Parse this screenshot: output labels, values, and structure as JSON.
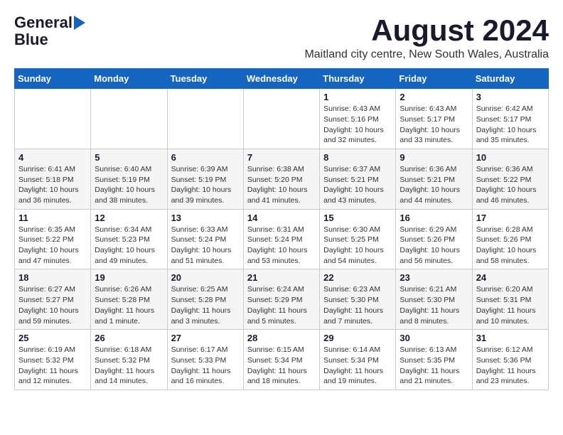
{
  "header": {
    "logo_line1": "General",
    "logo_line2": "Blue",
    "title": "August 2024",
    "subtitle": "Maitland city centre, New South Wales, Australia"
  },
  "days_of_week": [
    "Sunday",
    "Monday",
    "Tuesday",
    "Wednesday",
    "Thursday",
    "Friday",
    "Saturday"
  ],
  "weeks": [
    [
      {
        "day": "",
        "detail": ""
      },
      {
        "day": "",
        "detail": ""
      },
      {
        "day": "",
        "detail": ""
      },
      {
        "day": "",
        "detail": ""
      },
      {
        "day": "1",
        "detail": "Sunrise: 6:43 AM\nSunset: 5:16 PM\nDaylight: 10 hours\nand 32 minutes."
      },
      {
        "day": "2",
        "detail": "Sunrise: 6:43 AM\nSunset: 5:17 PM\nDaylight: 10 hours\nand 33 minutes."
      },
      {
        "day": "3",
        "detail": "Sunrise: 6:42 AM\nSunset: 5:17 PM\nDaylight: 10 hours\nand 35 minutes."
      }
    ],
    [
      {
        "day": "4",
        "detail": "Sunrise: 6:41 AM\nSunset: 5:18 PM\nDaylight: 10 hours\nand 36 minutes."
      },
      {
        "day": "5",
        "detail": "Sunrise: 6:40 AM\nSunset: 5:19 PM\nDaylight: 10 hours\nand 38 minutes."
      },
      {
        "day": "6",
        "detail": "Sunrise: 6:39 AM\nSunset: 5:19 PM\nDaylight: 10 hours\nand 39 minutes."
      },
      {
        "day": "7",
        "detail": "Sunrise: 6:38 AM\nSunset: 5:20 PM\nDaylight: 10 hours\nand 41 minutes."
      },
      {
        "day": "8",
        "detail": "Sunrise: 6:37 AM\nSunset: 5:21 PM\nDaylight: 10 hours\nand 43 minutes."
      },
      {
        "day": "9",
        "detail": "Sunrise: 6:36 AM\nSunset: 5:21 PM\nDaylight: 10 hours\nand 44 minutes."
      },
      {
        "day": "10",
        "detail": "Sunrise: 6:36 AM\nSunset: 5:22 PM\nDaylight: 10 hours\nand 46 minutes."
      }
    ],
    [
      {
        "day": "11",
        "detail": "Sunrise: 6:35 AM\nSunset: 5:22 PM\nDaylight: 10 hours\nand 47 minutes."
      },
      {
        "day": "12",
        "detail": "Sunrise: 6:34 AM\nSunset: 5:23 PM\nDaylight: 10 hours\nand 49 minutes."
      },
      {
        "day": "13",
        "detail": "Sunrise: 6:33 AM\nSunset: 5:24 PM\nDaylight: 10 hours\nand 51 minutes."
      },
      {
        "day": "14",
        "detail": "Sunrise: 6:31 AM\nSunset: 5:24 PM\nDaylight: 10 hours\nand 53 minutes."
      },
      {
        "day": "15",
        "detail": "Sunrise: 6:30 AM\nSunset: 5:25 PM\nDaylight: 10 hours\nand 54 minutes."
      },
      {
        "day": "16",
        "detail": "Sunrise: 6:29 AM\nSunset: 5:26 PM\nDaylight: 10 hours\nand 56 minutes."
      },
      {
        "day": "17",
        "detail": "Sunrise: 6:28 AM\nSunset: 5:26 PM\nDaylight: 10 hours\nand 58 minutes."
      }
    ],
    [
      {
        "day": "18",
        "detail": "Sunrise: 6:27 AM\nSunset: 5:27 PM\nDaylight: 10 hours\nand 59 minutes."
      },
      {
        "day": "19",
        "detail": "Sunrise: 6:26 AM\nSunset: 5:28 PM\nDaylight: 11 hours\nand 1 minute."
      },
      {
        "day": "20",
        "detail": "Sunrise: 6:25 AM\nSunset: 5:28 PM\nDaylight: 11 hours\nand 3 minutes."
      },
      {
        "day": "21",
        "detail": "Sunrise: 6:24 AM\nSunset: 5:29 PM\nDaylight: 11 hours\nand 5 minutes."
      },
      {
        "day": "22",
        "detail": "Sunrise: 6:23 AM\nSunset: 5:30 PM\nDaylight: 11 hours\nand 7 minutes."
      },
      {
        "day": "23",
        "detail": "Sunrise: 6:21 AM\nSunset: 5:30 PM\nDaylight: 11 hours\nand 8 minutes."
      },
      {
        "day": "24",
        "detail": "Sunrise: 6:20 AM\nSunset: 5:31 PM\nDaylight: 11 hours\nand 10 minutes."
      }
    ],
    [
      {
        "day": "25",
        "detail": "Sunrise: 6:19 AM\nSunset: 5:32 PM\nDaylight: 11 hours\nand 12 minutes."
      },
      {
        "day": "26",
        "detail": "Sunrise: 6:18 AM\nSunset: 5:32 PM\nDaylight: 11 hours\nand 14 minutes."
      },
      {
        "day": "27",
        "detail": "Sunrise: 6:17 AM\nSunset: 5:33 PM\nDaylight: 11 hours\nand 16 minutes."
      },
      {
        "day": "28",
        "detail": "Sunrise: 6:15 AM\nSunset: 5:34 PM\nDaylight: 11 hours\nand 18 minutes."
      },
      {
        "day": "29",
        "detail": "Sunrise: 6:14 AM\nSunset: 5:34 PM\nDaylight: 11 hours\nand 19 minutes."
      },
      {
        "day": "30",
        "detail": "Sunrise: 6:13 AM\nSunset: 5:35 PM\nDaylight: 11 hours\nand 21 minutes."
      },
      {
        "day": "31",
        "detail": "Sunrise: 6:12 AM\nSunset: 5:36 PM\nDaylight: 11 hours\nand 23 minutes."
      }
    ]
  ]
}
